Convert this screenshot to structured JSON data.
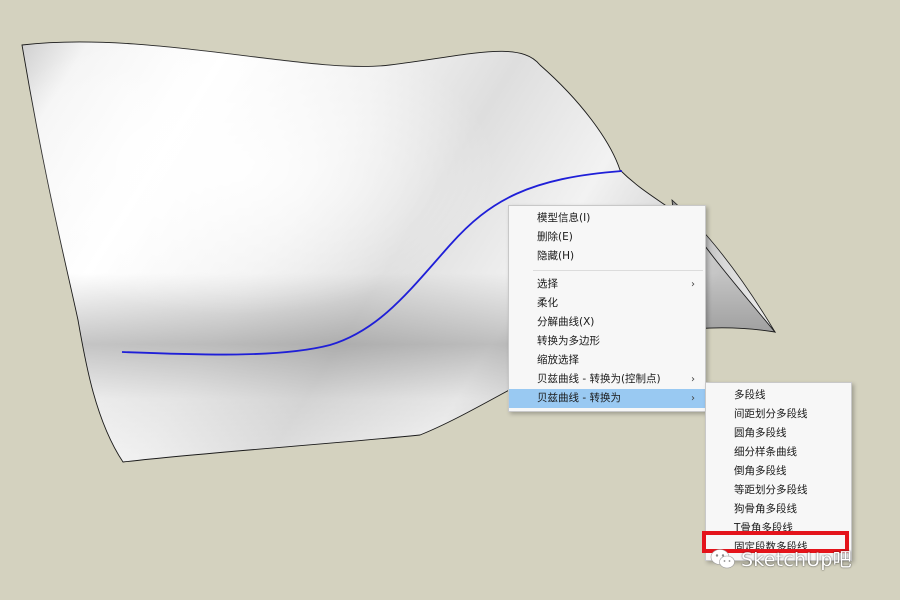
{
  "colors": {
    "background": "#d4d2bf",
    "curve": "#1f1fd8",
    "menu_highlight": "#99c9f2",
    "highlight_box": "#e4141b",
    "surface_edge": "#1a1a1a"
  },
  "context_menu": {
    "items": [
      {
        "label": "模型信息(I)"
      },
      {
        "label": "删除(E)"
      },
      {
        "label": "隐藏(H)"
      },
      {
        "label": "选择",
        "submenu": true
      },
      {
        "label": "柔化"
      },
      {
        "label": "分解曲线(X)"
      },
      {
        "label": "转换为多边形"
      },
      {
        "label": "缩放选择"
      },
      {
        "label": "贝兹曲线 - 转换为(控制点)",
        "submenu": true
      },
      {
        "label": "贝兹曲线 - 转换为",
        "submenu": true,
        "highlighted": true
      }
    ],
    "submenu_arrow": "›"
  },
  "submenu": {
    "items": [
      {
        "label": "多段线"
      },
      {
        "label": "间距划分多段线"
      },
      {
        "label": "圆角多段线"
      },
      {
        "label": "细分样条曲线"
      },
      {
        "label": "倒角多段线"
      },
      {
        "label": "等距划分多段线"
      },
      {
        "label": "狗骨角多段线"
      },
      {
        "label": "T骨角多段线"
      },
      {
        "label": "固定段数多段线",
        "boxed": true
      }
    ]
  },
  "watermark": {
    "text": "SketchUp吧",
    "icon": "wechat-icon"
  }
}
